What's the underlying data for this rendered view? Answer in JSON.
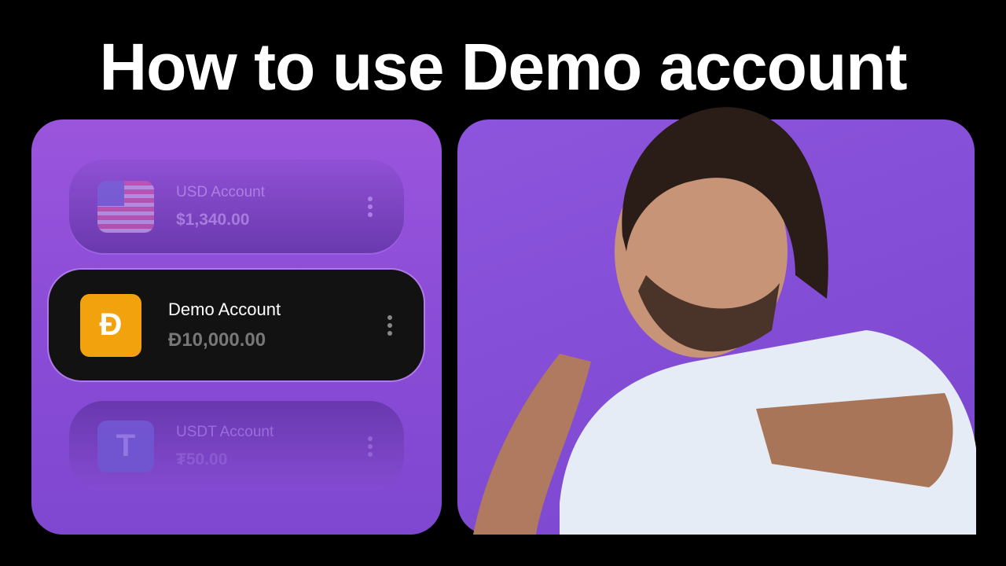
{
  "title": "How to use Demo account",
  "accounts": [
    {
      "name": "USD Account",
      "balance": "$1,340.00",
      "icon": "us-flag-icon",
      "state": "faded"
    },
    {
      "name": "Demo Account",
      "balance": "Đ10,000.00",
      "icon": "demo-coin-icon",
      "icon_glyph": "Đ",
      "icon_color": "#f2a20c",
      "state": "selected"
    },
    {
      "name": "USDT Account",
      "balance": "₮50.00",
      "icon": "tether-icon",
      "icon_glyph": "T",
      "state": "faded"
    }
  ],
  "colors": {
    "background": "#000000",
    "panel": "#8f50da",
    "selected_card": "#121212",
    "accent_border": "#b07ae8"
  }
}
